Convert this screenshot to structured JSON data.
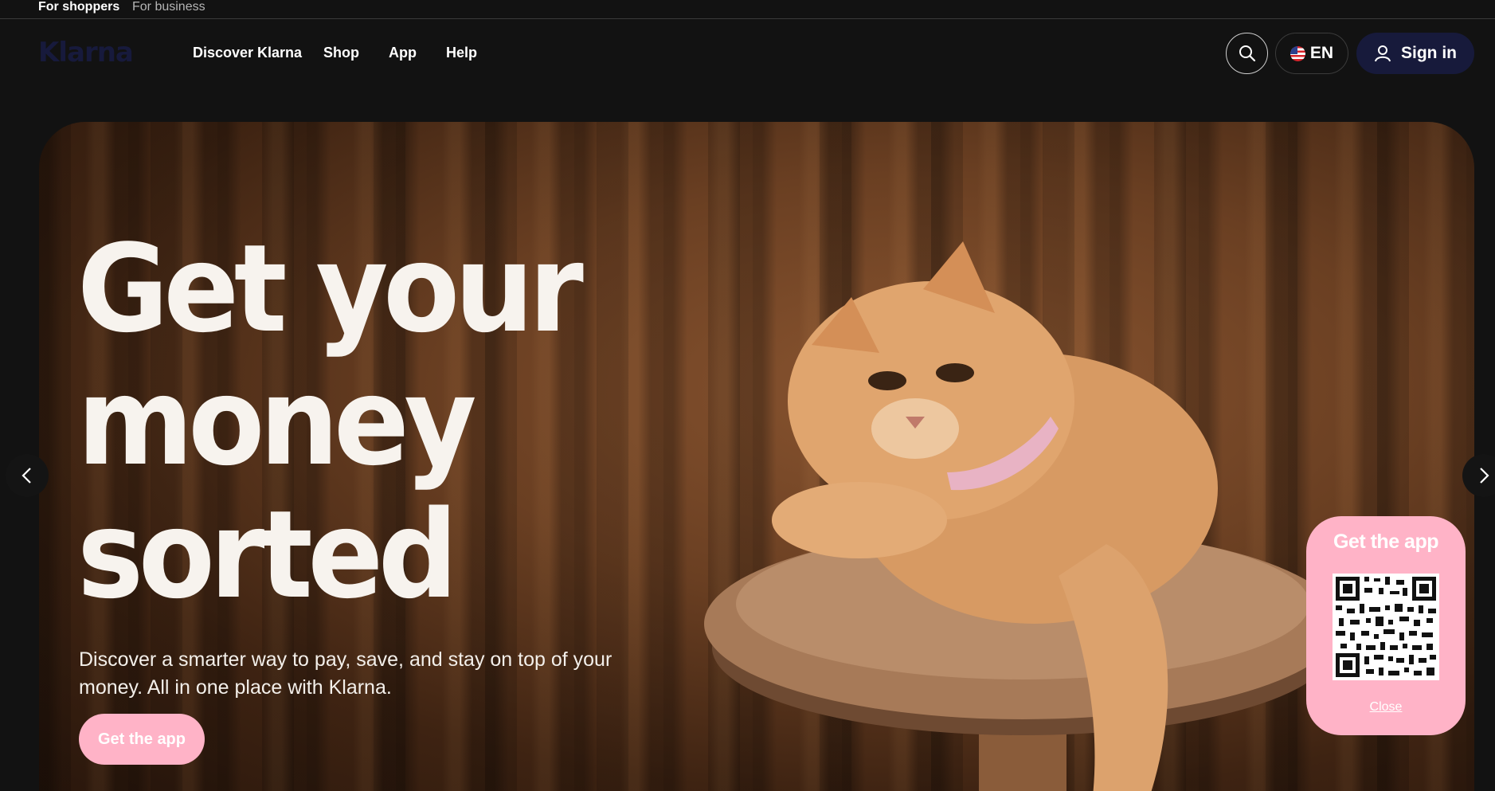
{
  "topbar": {
    "segment_shoppers": "For shoppers",
    "segment_business": "For business"
  },
  "header": {
    "logo": "Klarna",
    "nav": [
      "Discover Klarna",
      "Shop",
      "App",
      "Help"
    ],
    "language": "EN",
    "signin_label": "Sign in"
  },
  "hero": {
    "headline_lines": [
      "Get your",
      "money",
      "sorted"
    ],
    "subtext": "Discover a smarter way to pay, save, and stay on top of your money. All in one place with Klarna.",
    "cta_label": "Get the app"
  },
  "app_card": {
    "title": "Get the app",
    "close_label": "Close"
  },
  "colors": {
    "background": "#121212",
    "pink": "#ffb3c7",
    "navy": "#171a3b",
    "hero_brown": "#6a3f22"
  },
  "icons": [
    "search-icon",
    "us-flag-icon",
    "user-icon",
    "chevron-left-icon",
    "chevron-right-icon",
    "qr-code"
  ]
}
